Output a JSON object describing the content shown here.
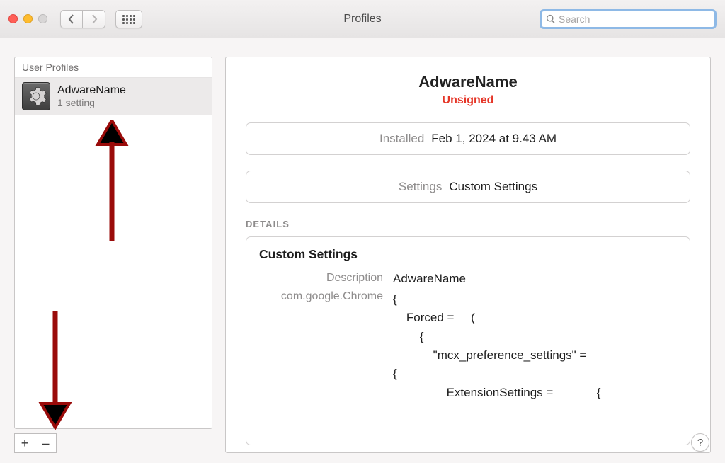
{
  "window": {
    "title": "Profiles",
    "search_placeholder": "Search"
  },
  "sidebar": {
    "section_title": "User Profiles",
    "profile": {
      "name": "AdwareName",
      "subtitle": "1 setting",
      "icon": "gear-icon"
    },
    "add_label": "+",
    "remove_label": "–"
  },
  "detail": {
    "title": "AdwareName",
    "status": "Unsigned",
    "rows": {
      "installed": {
        "label": "Installed",
        "value": "Feb 1, 2024 at 9.43 AM"
      },
      "settings": {
        "label": "Settings",
        "value": "Custom Settings"
      }
    },
    "section_label": "DETAILS",
    "box_title": "Custom Settings",
    "description": {
      "label": "Description",
      "value": "AdwareName"
    },
    "domain": {
      "label": "com.google.Chrome"
    },
    "code": "{\n    Forced =     (\n        {\n            \"mcx_preference_settings\" =\n{\n                ExtensionSettings =             {"
  },
  "help_label": "?"
}
